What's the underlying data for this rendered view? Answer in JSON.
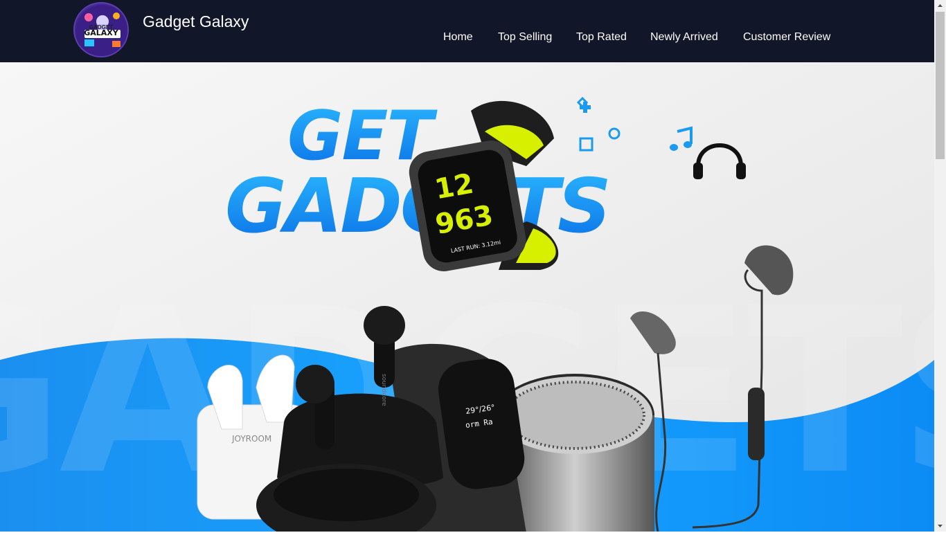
{
  "header": {
    "site_title": "Gadget Galaxy",
    "logo": {
      "text_top": "GADGET",
      "text_main": "GALAXY"
    }
  },
  "nav": {
    "items": [
      {
        "label": "Home"
      },
      {
        "label": "Top Selling"
      },
      {
        "label": "Top Rated"
      },
      {
        "label": "Newly Arrived"
      },
      {
        "label": "Customer Review"
      }
    ]
  },
  "hero": {
    "headline_line1": "GET",
    "headline_line2": "GADGETS",
    "background_word": "GADGETS",
    "watch_time_top": "12",
    "watch_time_bottom": "963",
    "watch_caption": "LAST RUN: 3.12mi",
    "earbuds_case_brand": "JOYROOM",
    "earbud_brand": "soundcore",
    "band_temp": "29°/26°",
    "band_text": "orm  Ra"
  },
  "colors": {
    "header_bg": "#111629",
    "accent_blue": "#1a9bf0",
    "watch_green": "#d6f000"
  },
  "icons": [
    "plus-icon",
    "circle-icon",
    "square-icon",
    "music-note-icon",
    "headphones-icon",
    "scroll-up-arrow-icon",
    "scroll-down-arrow-icon"
  ]
}
